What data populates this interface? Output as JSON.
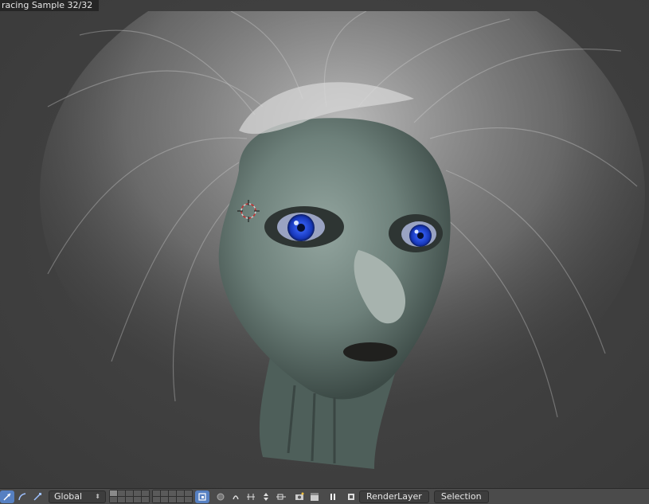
{
  "viewport": {
    "status_text": "racing Sample 32/32"
  },
  "footer": {
    "transform_orientation": "Global",
    "render_layer": "RenderLayer",
    "selection_label": "Selection",
    "icons": [
      "manipulator-icon",
      "rotate-icon",
      "scale-icon",
      "layer-lock-icon",
      "proportional-edit-icon",
      "snap-icon",
      "snap-target-icon",
      "snap-align-icon",
      "camera-render-icon",
      "clapper-icon",
      "pause-icon",
      "renderlayer-icon"
    ],
    "active_color": "#5680c2"
  }
}
